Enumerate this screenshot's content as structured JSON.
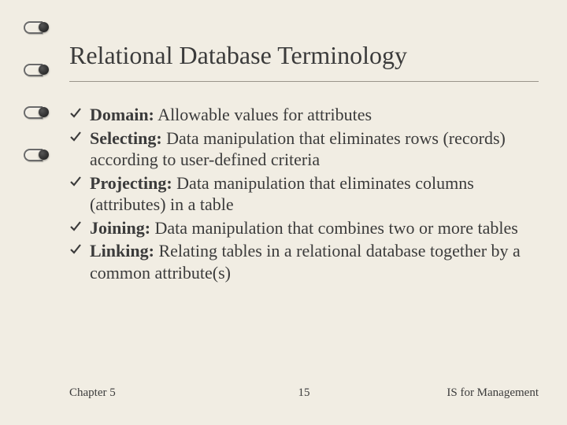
{
  "title": "Relational Database Terminology",
  "bullets": [
    {
      "term": "Domain:",
      "desc": " Allowable values for attributes"
    },
    {
      "term": "Selecting:",
      "desc": " Data manipulation that eliminates rows (records) according to user-defined criteria"
    },
    {
      "term": "Projecting:",
      "desc": " Data manipulation that eliminates columns (attributes) in a table"
    },
    {
      "term": "Joining:",
      "desc": " Data manipulation that combines two or more tables"
    },
    {
      "term": "Linking:",
      "desc": " Relating tables in a relational database together by a common attribute(s)"
    }
  ],
  "footer": {
    "left": "Chapter 5",
    "center": "15",
    "right": "IS for Management"
  }
}
